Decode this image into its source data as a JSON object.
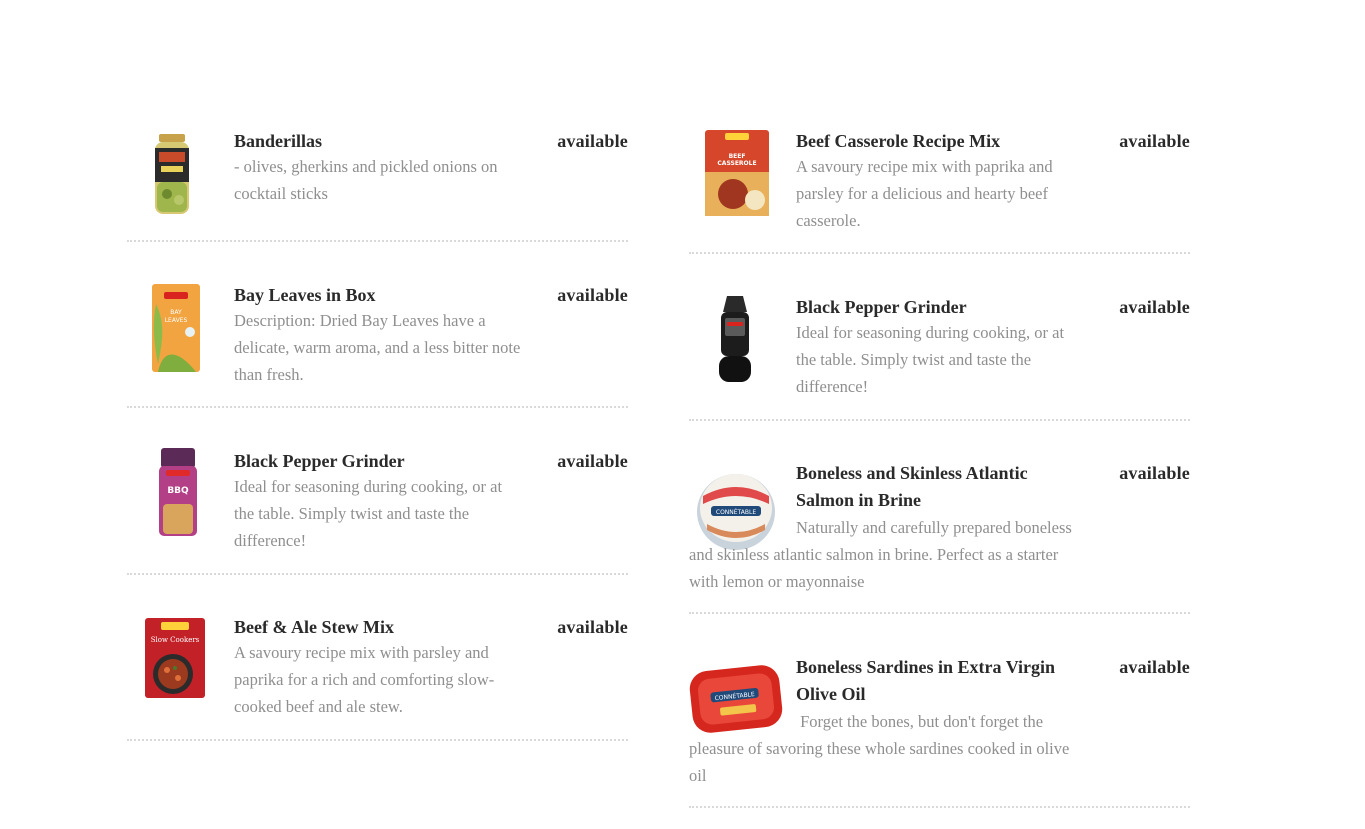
{
  "status_label": "available",
  "left_items": [
    {
      "title": "Banderillas",
      "description": "- olives, gherkins and pickled onions on cocktail sticks",
      "image": "banderillas-jar-image"
    },
    {
      "title": "Bay Leaves in Box",
      "description": "Description: Dried Bay Leaves have a delicate, warm aroma, and a less bitter note than fresh.",
      "image": "bay-leaves-box-image"
    },
    {
      "title": "Black Pepper Grinder",
      "description": "Ideal for seasoning during cooking, or at the table. Simply twist and taste the difference!",
      "image": "bbq-seasoning-jar-image"
    },
    {
      "title": "Beef & Ale Stew Mix",
      "description": "A savoury recipe mix with parsley and paprika for a rich and comforting slow-cooked beef and ale stew.",
      "image": "beef-ale-stew-packet-image"
    }
  ],
  "right_items": [
    {
      "title": "Beef Casserole Recipe Mix",
      "description": "A savoury recipe mix with paprika and parsley for a delicious and hearty beef casserole.",
      "image": "beef-casserole-packet-image"
    },
    {
      "title": "Black Pepper Grinder",
      "description": "Ideal for seasoning during cooking, or at the table. Simply twist and taste the difference!",
      "image": "pepper-grinder-image"
    },
    {
      "title": "Boneless and Skinless Atlantic Salmon in Brine",
      "description": "Naturally and carefully prepared boneless and skinless atlantic salmon in brine. Perfect as a starter with lemon or mayonnaise",
      "image": "salmon-tin-image"
    },
    {
      "title": "Boneless Sardines in Extra Virgin Olive Oil",
      "description": " Forget the bones, but don't forget the pleasure of savoring these whole sardines cooked in olive oil",
      "image": "sardines-tin-image"
    }
  ],
  "colors": {
    "title": "#2a2a2a",
    "description": "#8f8f8f",
    "divider": "#d9d9d9"
  }
}
